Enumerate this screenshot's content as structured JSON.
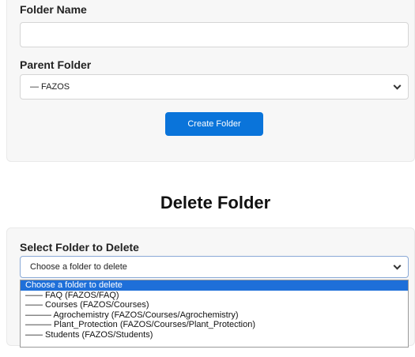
{
  "create_form": {
    "folder_name_label": "Folder Name",
    "folder_name_value": "",
    "parent_folder_label": "Parent Folder",
    "parent_folder_selected": "— FAZOS",
    "create_button_label": "Create Folder"
  },
  "delete_section": {
    "heading": "Delete Folder",
    "select_label": "Select Folder to Delete",
    "select_selected": "Choose a folder to delete",
    "options": [
      "Choose a folder to delete",
      "—— FAQ (FAZOS/FAQ)",
      "—— Courses (FAZOS/Courses)",
      "——— Agrochemistry (FAZOS/Courses/Agrochemistry)",
      "——— Plant_Protection (FAZOS/Courses/Plant_Protection)",
      "—— Students (FAZOS/Students)"
    ],
    "highlighted_index": 0
  },
  "colors": {
    "primary_button": "#0a74da",
    "highlight": "#1e6fd9"
  }
}
